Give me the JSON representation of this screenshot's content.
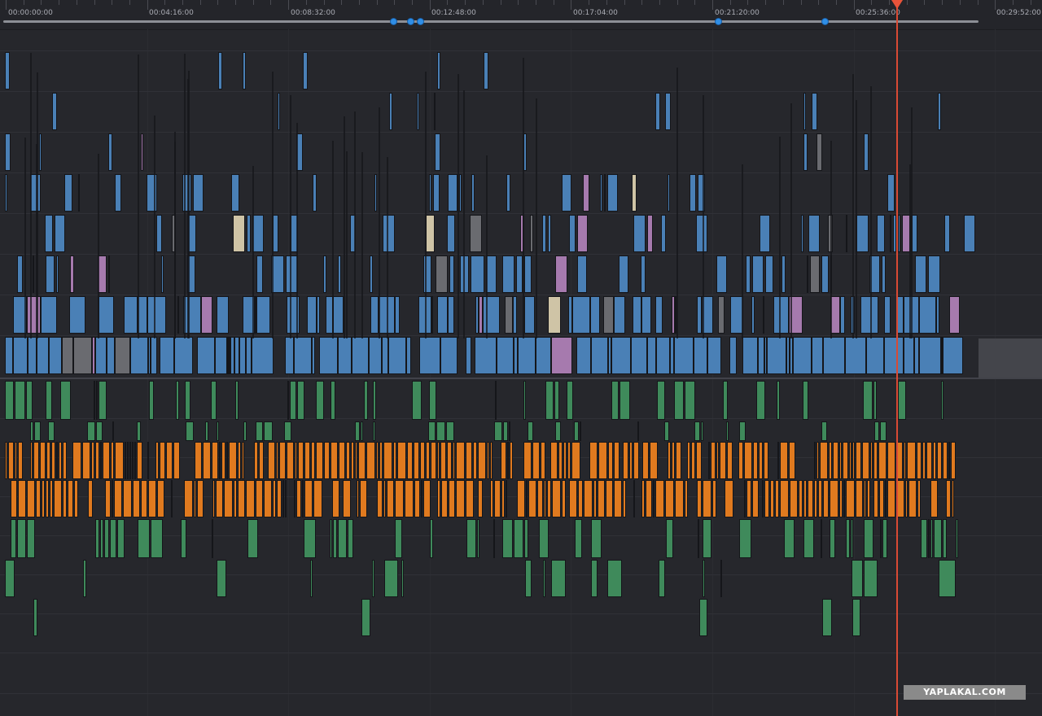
{
  "ruler": {
    "timecodes": [
      "00:00:00:00",
      "00:04:16:00",
      "00:08:32:00",
      "00:12:48:00",
      "00:17:04:00",
      "00:21:20:00",
      "00:25:36:00",
      "00:29:52:00"
    ],
    "duration_seconds": 1792,
    "markers_seconds": [
      702,
      732,
      750,
      1290,
      1483
    ]
  },
  "playhead": {
    "timecode_seconds": 1613
  },
  "colors": {
    "video_blue": "#4a80b6",
    "video_pink": "#a67aae",
    "video_beige": "#cfc4a6",
    "video_grey": "#6a6b70",
    "audio_green": "#3f8a5b",
    "audio_orange": "#e07a1f",
    "marker_blue": "#2f8ee6",
    "playhead_red": "#d94a34",
    "background": "#26272c"
  },
  "watermark": {
    "text": "YAPLAKAL.COM"
  }
}
